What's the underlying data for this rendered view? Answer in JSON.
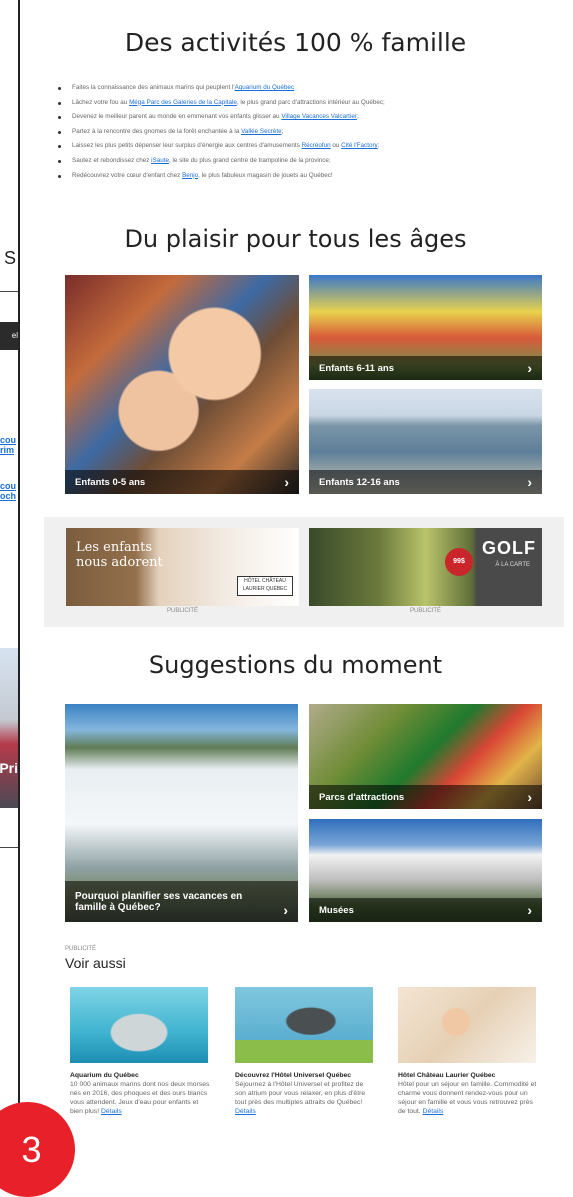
{
  "left_fragments": {
    "letter": "S",
    "chip": "el",
    "links": [
      "cou",
      "rim",
      "cou",
      "och"
    ],
    "photo_text": "Pri"
  },
  "section1": {
    "title": "Des activités 100 % famille",
    "bullets": [
      {
        "pre": "Faites la connaissance des animaux marins qui peuplent l'",
        "link": "Aquarium du Québec",
        "post": ""
      },
      {
        "pre": "Lâchez votre fou au ",
        "link": "Méga Parc des Galeries de la Capitale",
        "post": ", le plus grand parc d'attractions intérieur au Québec;"
      },
      {
        "pre": "Devenez le meilleur parent au monde en emmenant vos enfants glisser au ",
        "link": "Village Vacances Valcartier",
        "post": ";"
      },
      {
        "pre": "Partez à la rencontre des gnomes de la forêt enchantée à la ",
        "link": "Vallée Secrète",
        "post": ";"
      },
      {
        "pre": "Laissez les plus petits dépenser leur surplus d'énergie aux centres d'amusements ",
        "link": "Récréofun",
        "post": " ou ",
        "link2": "Cité l'Factory",
        "post2": ";"
      },
      {
        "pre": "Sautez et rebondissez chez ",
        "link": "iSaute",
        "post": ", le site du plus grand centre de trampoline de la province;"
      },
      {
        "pre": "Redécouvrez votre cœur d'enfant chez ",
        "link": "Benjo",
        "post": ", le plus fabuleux magasin de jouets au Québec!"
      }
    ]
  },
  "section2": {
    "title": "Du plaisir pour tous les âges",
    "tiles": [
      "Enfants 0-5 ans",
      "Enfants 6-11 ans",
      "Enfants 12-16 ans"
    ]
  },
  "ads": {
    "ad1_text": "Les enfants nous adorent",
    "ad1_logo": "HÔTEL CHÂTEAU LAURIER QUÉBEC",
    "ad2_golf": "GOLF",
    "ad2_sub": "À LA CARTE",
    "ad2_badge": "99$",
    "label": "PUBLICITÉ"
  },
  "section3": {
    "title": "Suggestions du moment",
    "tiles": [
      "Pourquoi planifier ses vacances en famille à Québec?",
      "Parcs d'attractions",
      "Musées"
    ]
  },
  "voir_aussi": {
    "pub_label": "PUBLICITÉ",
    "title": "Voir aussi",
    "cards": [
      {
        "title": "Aquarium du Québec",
        "desc": "10 000 animaux marins dont nos deux morses nés en 2016, des phoques et des ours blancs vous attendent. Jeux d'eau pour enfants et bien plus! ",
        "link": "Détails"
      },
      {
        "title": "Découvrez l'Hôtel Universel Québec",
        "desc": "Séjournez à l'Hôtel Universel et profitez de son atrium pour vous relaxer, en plus d'être tout près des multiples attraits de Québec! ",
        "link": "Détails"
      },
      {
        "title": "Hôtel Château Laurier Québec",
        "desc": "Hôtel pour un séjour en famille. Commodité et charme vous donnent rendez-vous pour un séjour en famille et vous vous retrouvez près de tout. ",
        "link": "Détails"
      }
    ]
  },
  "chevron": "›",
  "step_badge": "3"
}
